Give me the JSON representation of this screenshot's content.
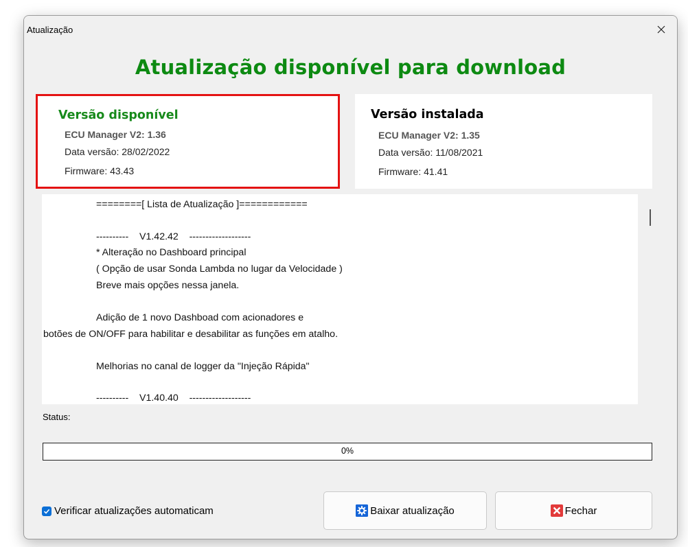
{
  "window": {
    "title": "Atualização"
  },
  "heading": "Atualização disponível para download",
  "available": {
    "title": "Versão disponível",
    "product": "ECU Manager V2: 1.36",
    "date": "Data versão: 28/02/2022",
    "firmware": "Firmware: 43.43"
  },
  "installed": {
    "title": "Versão instalada",
    "product": "ECU Manager V2: 1.35",
    "date": "Data versão: 11/08/2021",
    "firmware": "Firmware: 41.41"
  },
  "notes": [
    "========[ Lista de Atualização ]============",
    "----------    V1.42.42    -------------------",
    "* Alteração no Dashboard principal",
    "( Opção de usar Sonda Lambda no lugar da Velocidade )",
    "Breve mais opções nessa janela.",
    "Adição de 1 novo Dashboad com acionadores e",
    "botões de ON/OFF para habilitar e desabilitar as funções em atalho.",
    "Melhorias no canal de logger da \"Injeção Rápida\"",
    "----------    V1.40.40    -------------------"
  ],
  "status": {
    "label": "Status:",
    "progress_text": "0%",
    "progress": 0
  },
  "auto_check": {
    "label": "Verificar atualizações automaticam",
    "checked": true
  },
  "buttons": {
    "download": "Baixar atualização",
    "close": "Fechar"
  },
  "colors": {
    "heading": "#0d8a12",
    "highlight": "#e41212",
    "checkbox": "#0b6fd6"
  }
}
